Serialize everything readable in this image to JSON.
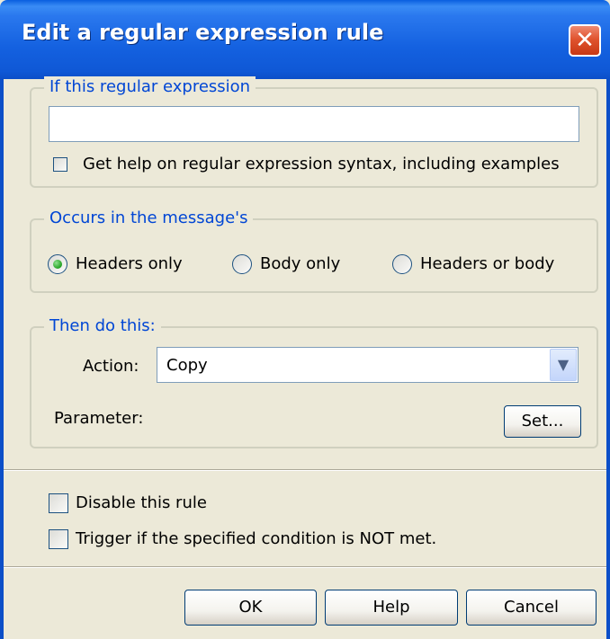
{
  "window": {
    "title": "Edit a regular expression rule",
    "close_icon": "close-icon",
    "colors": {
      "titlebar": "#0c4fc8",
      "close": "#e0542f",
      "group_title": "#0046d5",
      "face": "#ece9d8"
    }
  },
  "regex_group": {
    "legend": "If this regular expression",
    "regex_value": "",
    "help_checkbox_label": "Get help on regular expression syntax, including examples",
    "help_checked": false
  },
  "occurs_group": {
    "legend": "Occurs in the message's",
    "options": [
      "Headers only",
      "Body only",
      "Headers or body"
    ],
    "selected": "Headers only"
  },
  "action_group": {
    "legend": "Then do this:",
    "action_label": "Action:",
    "action_value": "Copy",
    "parameter_label": "Parameter:",
    "set_button": "Set..."
  },
  "options": {
    "disable_label": "Disable this rule",
    "disable_checked": false,
    "trigger_label": "Trigger if the specified condition is NOT met.",
    "trigger_checked": false
  },
  "buttons": {
    "ok": "OK",
    "help": "Help",
    "cancel": "Cancel"
  }
}
